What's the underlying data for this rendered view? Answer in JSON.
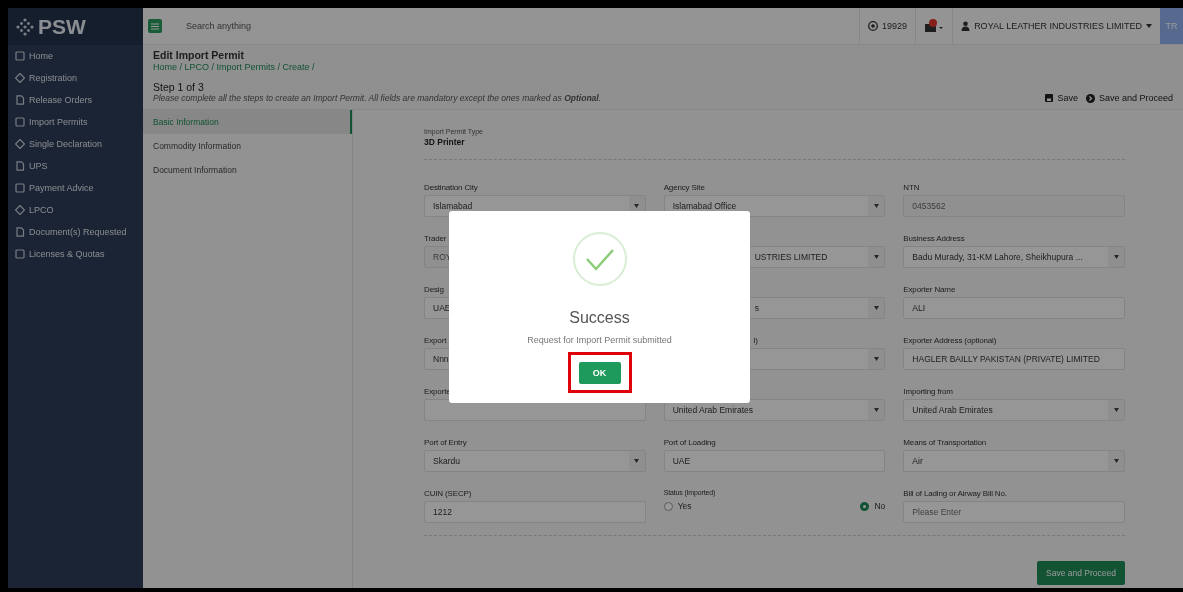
{
  "brand": "PSW",
  "search": {
    "placeholder": "Search anything"
  },
  "topbar": {
    "points": "19929",
    "user": "ROYAL LEATHER INDUSTRIES LIMITED",
    "avatar": "TR"
  },
  "sidebar": {
    "items": [
      {
        "label": "Home"
      },
      {
        "label": "Registration"
      },
      {
        "label": "Release Orders"
      },
      {
        "label": "Import Permits"
      },
      {
        "label": "Single Declaration"
      },
      {
        "label": "UPS"
      },
      {
        "label": "Payment Advice"
      },
      {
        "label": "LPCO"
      },
      {
        "label": "Document(s) Requested"
      },
      {
        "label": "Licenses & Quotas"
      }
    ]
  },
  "page": {
    "title": "Edit Import Permit",
    "breadcrumb": "Home / LPCO / Import Permits / Create /",
    "step": "Step 1 of 3",
    "note": "Please complete all the steps to create an Import Permit. All fields are mandatory except the ones marked as **Optional**."
  },
  "actions": [
    "Save",
    "Save and Proceed"
  ],
  "tabs": [
    {
      "label": "Basic Information",
      "selected": true
    },
    {
      "label": "Commodity Information",
      "selected": false
    },
    {
      "label": "Document Information",
      "selected": false
    }
  ],
  "permit_type": {
    "label": "Import Permit Type",
    "value": "3D Printer"
  },
  "fields": [
    {
      "kind": "select",
      "label": "Destination City",
      "value": "Islamabad"
    },
    {
      "kind": "select",
      "label": "Agency Site",
      "value": "Islamabad Office"
    },
    {
      "kind": "input",
      "label": "NTN",
      "value": "0453562",
      "disabled": true
    },
    {
      "kind": "input",
      "label": "Trader",
      "value": "ROY",
      "disabled": true
    },
    {
      "kind": "select",
      "value": "USTRIES LIMITED",
      "partial": true
    },
    {
      "kind": "select",
      "label": "Business Address",
      "value": "Badu Murady, 31-KM Lahore, Sheikhupura ..."
    },
    {
      "kind": "input",
      "label": "Desig",
      "value": "UAE"
    },
    {
      "kind": "select",
      "value": "s",
      "partial": true
    },
    {
      "kind": "input",
      "label": "Exporter Name",
      "value": "ALI"
    },
    {
      "kind": "input",
      "label": "Export",
      "value": "Nnn"
    },
    {
      "kind": "select",
      "label": "l)",
      "partial": true
    },
    {
      "kind": "input",
      "label": "Exporter Address (optional)",
      "value": "HAGLER BAILLY PAKISTAN (PRIVATE) LIMITED"
    },
    {
      "kind": "input",
      "label": "Exporte"
    },
    {
      "kind": "select",
      "value": "United Arab Emirates"
    },
    {
      "kind": "select",
      "label": "Importing from",
      "value": "United Arab Emirates"
    },
    {
      "kind": "select",
      "label": "Port of Entry",
      "value": "Skardu"
    },
    {
      "kind": "input",
      "label": "Port of Loading",
      "value": "UAE"
    },
    {
      "kind": "select",
      "label": "Means of Transportation",
      "value": "Air"
    },
    {
      "kind": "input",
      "label": "CUIN (SECP)",
      "value": "1212"
    },
    {
      "kind": "radio",
      "label": "Status (Imported)",
      "options": [
        {
          "label": "Yes",
          "selected": false
        },
        {
          "label": "No",
          "selected": true
        }
      ]
    },
    {
      "kind": "input",
      "label": "Bill of Lading or Airway Bill No.",
      "placeholder": "Please Enter"
    }
  ],
  "submit": "Save and Proceed",
  "dialog": {
    "title": "Success",
    "message": "Request for Import Permit submitted",
    "button": "OK"
  }
}
